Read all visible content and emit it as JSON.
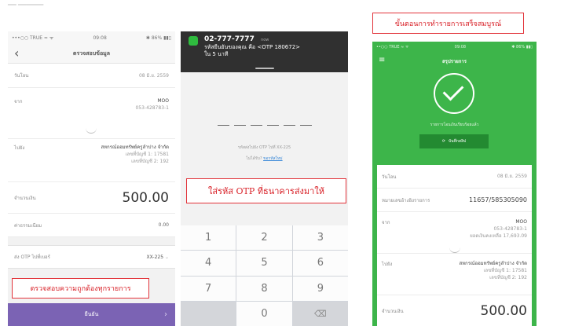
{
  "screen1": {
    "status_left": "•••○○ TRUE ≈ ᯤ",
    "status_time": "09:08",
    "status_right": "✱ 86% ▮▮▯",
    "title": "ตรวจสอบข้อมูล",
    "date_label": "วันโอน",
    "date_value": "08 มิ.ย. 2559",
    "from_label": "จาก",
    "from_name": "MOO",
    "from_account": "053-428783-1",
    "to_label": "ไปยัง",
    "to_name": "สหกรณ์ออมทรัพย์ครูลำปาง จำกัด",
    "to_line1": "เลขที่บัญชี 1: 17581",
    "to_line2": "เลขที่บัญชี 2: 192",
    "amount_label": "จำนวนเงิน",
    "amount_value": "500.00",
    "fee_label": "ค่าธรรมเนียม",
    "fee_value": "0.00",
    "otp_label": "ส่ง OTP ไปที่เบอร์",
    "otp_value": "XX-225",
    "confirm_label": "ยืนยัน"
  },
  "screen2": {
    "notif_number": "02-777-7777",
    "notif_time": "now",
    "notif_line1": "รหัสยืนยันของคุณ คือ <OTP 180672>",
    "notif_line2": "ใน 5 นาที",
    "otp_hint": "รหัสส่งไปยัง OTP ไปที่ XX-225",
    "resend_prefix": "ไม่ได้รับ?",
    "resend_link": "ขอรหัสใหม่",
    "keys": [
      "1",
      "2",
      "3",
      "4",
      "5",
      "6",
      "7",
      "8",
      "9",
      "",
      "0",
      "⌫"
    ]
  },
  "screen3": {
    "status_left": "••○○ TRUE ≈ ᯤ",
    "status_time": "09:08",
    "status_right": "✱ 86% ▮▮▯",
    "title": "สรุปรายการ",
    "success_text": "รายการโอนเงินเรียบร้อยแล้ว",
    "share_label": "บันทึกสลิป",
    "date_label": "วันโอน",
    "date_value": "08 มิ.ย. 2559",
    "ref_label": "หมายเลขอ้างอิงรายการ",
    "ref_value": "11657/585305090",
    "from_label": "จาก",
    "from_name": "MOO",
    "from_account": "053-428783-1",
    "from_balance": "ยอดเงินคงเหลือ 17,693.09",
    "to_label": "ไปยัง",
    "to_name": "สหกรณ์ออมทรัพย์ครูลำปาง จำกัด",
    "to_line1": "เลขที่บัญชี 1: 17581",
    "to_line2": "เลขที่บัญชี 2: 192",
    "amount_label": "จำนวนเงิน",
    "amount_value": "500.00"
  },
  "callouts": {
    "verify": "ตรวจสอบความถูกต้องทุกรายการ",
    "otp": "ใส่รหัส OTP ที่ธนาคารส่งมาให้",
    "complete": "ขั้นตอนการทำรายการเสร็จสมบูรณ์"
  },
  "colors": {
    "confirm_bar": "#7b63b4",
    "success_green": "#3db54a",
    "callout_red": "#d81f26"
  }
}
